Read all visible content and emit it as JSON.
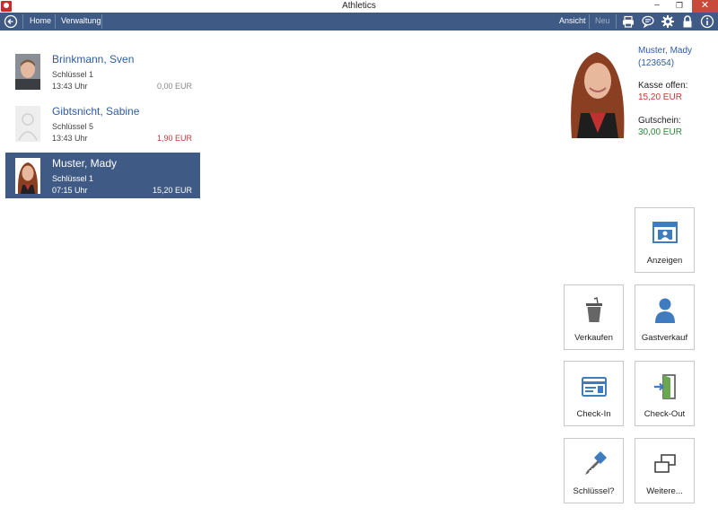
{
  "window": {
    "title": "Athletics"
  },
  "nav": {
    "home": "Home",
    "verwaltung": "Verwaltung",
    "ansicht": "Ansicht",
    "neu": "Neu"
  },
  "people": [
    {
      "name": "Brinkmann, Sven",
      "key": "Schlüssel 1",
      "time": "13:43 Uhr",
      "amount": "0,00 EUR"
    },
    {
      "name": "Gibtsnicht, Sabine",
      "key": "Schlüssel 5",
      "time": "13:43 Uhr",
      "amount": "1,90 EUR"
    },
    {
      "name": "Muster, Mady",
      "key": "Schlüssel 1",
      "time": "07:15 Uhr",
      "amount": "15,20 EUR"
    }
  ],
  "info": {
    "name": "Muster, Mady",
    "id": "(123654)",
    "kasse_label": "Kasse offen:",
    "kasse_value": "15,20 EUR",
    "gutschein_label": "Gutschein:",
    "gutschein_value": "30,00 EUR"
  },
  "actions": {
    "anzeigen": "Anzeigen",
    "verkaufen": "Verkaufen",
    "gastverkauf": "Gastverkauf",
    "checkin": "Check-In",
    "checkout": "Check-Out",
    "schluessel": "Schlüssel?",
    "weitere": "Weitere..."
  },
  "colors": {
    "accent": "#3f5b85",
    "link": "#2f5ba3",
    "negative": "#c23a3a",
    "positive": "#2e8b3a",
    "icon_blue": "#3e7bbf"
  }
}
